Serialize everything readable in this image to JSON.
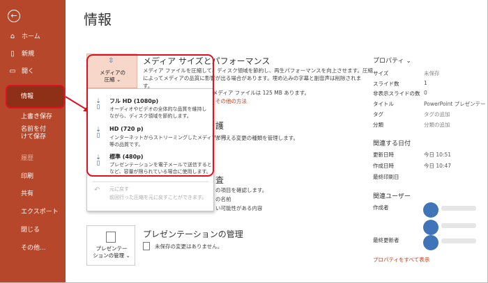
{
  "sidebar": {
    "back": "⊖",
    "items": [
      {
        "label": "ホーム",
        "icon": "home-icon"
      },
      {
        "label": "新規",
        "icon": "new-file-icon"
      },
      {
        "label": "開く",
        "icon": "open-folder-icon"
      },
      {
        "label": "情報",
        "active": true
      },
      {
        "label": "上書き保存"
      },
      {
        "label": "名前を付けて保存"
      },
      {
        "label": "履歴"
      },
      {
        "label": "印刷"
      },
      {
        "label": "共有"
      },
      {
        "label": "エクスポート"
      },
      {
        "label": "閉じる"
      },
      {
        "label": "その他..."
      }
    ]
  },
  "page_title": "情報",
  "media": {
    "title": "メディア サイズとパフォーマンス",
    "desc_line1": "メディア ファイルを圧縮して、ディスク領域を節約し、再生パフォーマンスを向上させます。圧縮",
    "desc_line2": "によってメディアの品質に影響が出る場合があります。埋め込みの字幕と副音声は削除されま",
    "desc_line3": "す。",
    "size_note": "このプレゼンテーションのメディア ファイルは 125 MB あります。",
    "link": "その他の方法",
    "tile_label_1": "メディアの",
    "tile_label_2": "圧縮",
    "tile_chevron": "⌄"
  },
  "dropdown": {
    "options": [
      {
        "title": "フル HD (1080p)",
        "desc1": "オーディオやビデオの全体的な品質を維持し",
        "desc2": "ながら、ディスク領域を節約します。"
      },
      {
        "title": "HD (720 p)",
        "desc1": "インターネットからストリーミングしたメディアと同",
        "desc2": "等の品質です。"
      },
      {
        "title": "標準 (480p)",
        "desc1": "プレゼンテーションを電子メールで送信すると",
        "desc2": "など、容量が限られている場合に使用します。"
      }
    ],
    "undo_title": "元に戻す",
    "undo_desc": "前回行った圧縮を元に戻すことができます。"
  },
  "protect": {
    "title_fragment": "護",
    "desc_fragment": "が行える変更の種類を管理します。"
  },
  "inspect": {
    "title_fragment": "査",
    "desc1": "の項目を確認します。",
    "desc2": "の名前",
    "desc3": "い可能性がある内容"
  },
  "manage": {
    "title": "プレゼンテーションの管理",
    "note": "未保存の変更はありません。",
    "tile_label_1": "プレゼンテー",
    "tile_label_2": "ションの管理",
    "tile_chevron": "⌄"
  },
  "properties": {
    "header": "プロパティ",
    "rows": [
      {
        "k": "サイズ",
        "v": "未保存"
      },
      {
        "k": "スライド数",
        "v": "1"
      },
      {
        "k": "非表示スライドの数",
        "v": "0"
      },
      {
        "k": "タイトル",
        "v": "PowerPoint プレゼンテー"
      },
      {
        "k": "タグ",
        "v": "タグの追加"
      },
      {
        "k": "分類",
        "v": "分類の追加"
      }
    ],
    "dates_header": "関連する日付",
    "dates": [
      {
        "k": "更新日時",
        "v": "今日 10:51"
      },
      {
        "k": "作成日時",
        "v": "今日 10:47"
      },
      {
        "k": "最終印刷日",
        "v": ""
      }
    ],
    "users_header": "関連ユーザー",
    "author_label": "作成者",
    "last_modified_label": "最終更新者",
    "all_props_link": "プロパティをすべて表示"
  },
  "colors": {
    "sidebar": "#b7472a",
    "accent_red": "#e0101e",
    "tile_bg": "#f6d7ca"
  }
}
